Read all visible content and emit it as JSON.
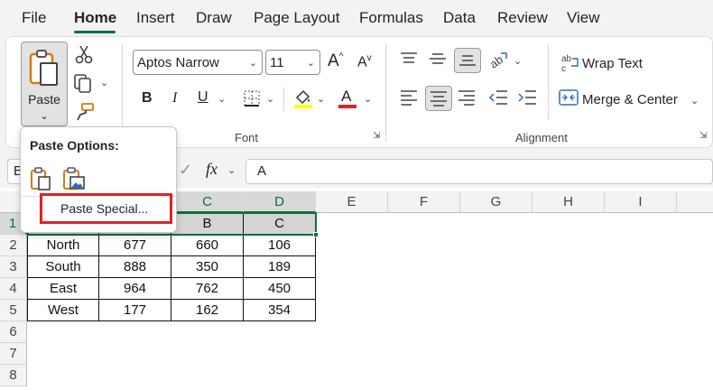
{
  "menu": {
    "tabs": [
      {
        "label": "File"
      },
      {
        "label": "Home"
      },
      {
        "label": "Insert"
      },
      {
        "label": "Draw"
      },
      {
        "label": "Page Layout"
      },
      {
        "label": "Formulas"
      },
      {
        "label": "Data"
      },
      {
        "label": "Review"
      },
      {
        "label": "View"
      }
    ],
    "active": "Home"
  },
  "clipboard": {
    "paste_label": "Paste"
  },
  "font": {
    "group_label": "Font",
    "name": "Aptos Narrow",
    "size": "11",
    "bold": "B",
    "italic": "I",
    "underline": "U",
    "font_color_letter": "A",
    "highlight_color": "#ffff00",
    "font_color": "#e32026"
  },
  "alignment": {
    "group_label": "Alignment",
    "wrap_text": "Wrap Text",
    "merge_center": "Merge & Center"
  },
  "formula_bar": {
    "name_box": "B",
    "fx": "fx",
    "value": "A"
  },
  "paste_menu": {
    "title": "Paste Options:",
    "paste_special": "Paste Special..."
  },
  "grid": {
    "columns": [
      "C",
      "D",
      "E",
      "F",
      "G",
      "H",
      "I"
    ],
    "rows": [
      "1",
      "2",
      "3",
      "4",
      "5",
      "6",
      "7",
      "8"
    ],
    "row1": [
      "B",
      "C"
    ],
    "data": [
      [
        "North",
        "677",
        "660",
        "106"
      ],
      [
        "South",
        "888",
        "350",
        "189"
      ],
      [
        "East",
        "964",
        "762",
        "450"
      ],
      [
        "West",
        "177",
        "162",
        "354"
      ]
    ]
  },
  "colors": {
    "accent_green": "#0f6f3a",
    "highlight_red": "#e32026"
  }
}
